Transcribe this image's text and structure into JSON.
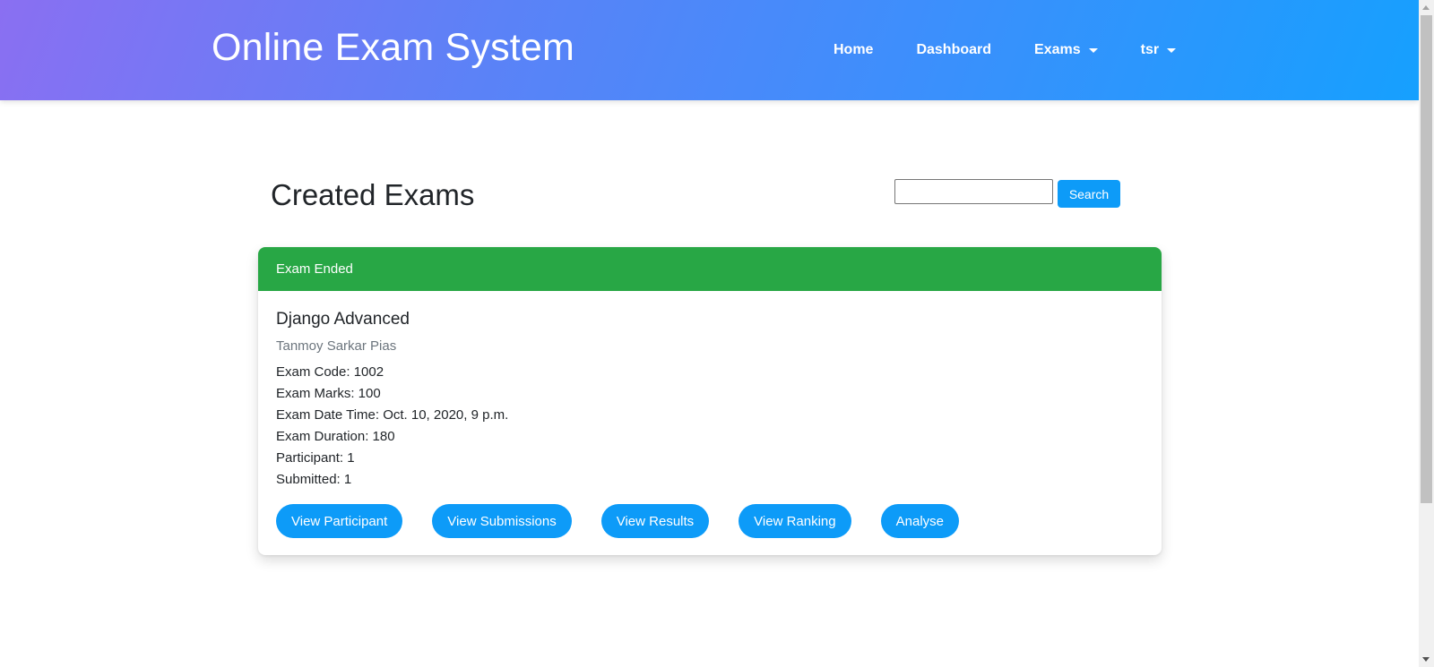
{
  "navbar": {
    "brand": "Online Exam System",
    "items": [
      {
        "label": "Home",
        "dropdown": false
      },
      {
        "label": "Dashboard",
        "dropdown": false
      },
      {
        "label": "Exams",
        "dropdown": true
      },
      {
        "label": "tsr",
        "dropdown": true
      }
    ]
  },
  "page": {
    "title": "Created Exams"
  },
  "search": {
    "value": "",
    "placeholder": "",
    "button_label": "Search"
  },
  "exam_card": {
    "status": "Exam Ended",
    "status_color": "#28a745",
    "title": "Django Advanced",
    "author": "Tanmoy Sarkar Pias",
    "details": [
      "Exam Code: 1002",
      "Exam Marks: 100",
      "Exam Date Time: Oct. 10, 2020, 9 p.m.",
      "Exam Duration: 180",
      "Participant: 1",
      "Submitted: 1"
    ],
    "actions": [
      "View Participant",
      "View Submissions",
      "View Results",
      "View Ranking",
      "Analyse"
    ]
  },
  "colors": {
    "navbar_gradient_start": "#8a6ff2",
    "navbar_gradient_end": "#16a0fe",
    "primary_button": "#0d9bf8",
    "success_header": "#28a745"
  }
}
